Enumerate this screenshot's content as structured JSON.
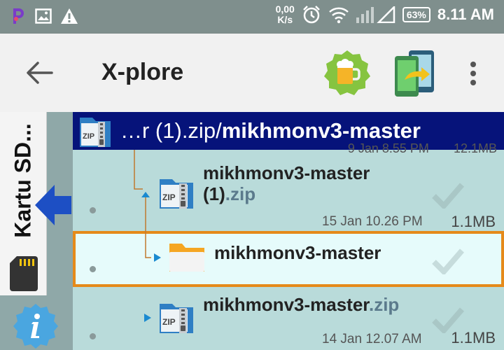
{
  "status_bar": {
    "speed_value": "0,00",
    "speed_unit": "K/s",
    "battery": "63%",
    "time": "8.11 AM",
    "icons": [
      "pinterest-icon",
      "image-icon",
      "warning-icon",
      "alarm-icon",
      "wifi-icon",
      "signal-icon",
      "battery-icon"
    ]
  },
  "app_bar": {
    "title": "X-plore",
    "icons": [
      "back-arrow-icon",
      "beer-icon",
      "phone-transfer-icon",
      "more-vert-icon"
    ]
  },
  "side_panel": {
    "label": "Kartu SD...",
    "icons": [
      "sd-card-icon",
      "arrow-left-icon",
      "info-icon"
    ]
  },
  "path_bar": {
    "prefix": "…r (1).zip/",
    "current": "mikhmonv3-master"
  },
  "list": {
    "cut_row": {
      "date": "9 Jan 8.55 PM",
      "size": "12.1MB"
    },
    "items": [
      {
        "name_line1": "mikhmonv3-master",
        "name_line2": "(1)",
        "ext": ".zip",
        "date": "15 Jan 10.26 PM",
        "size": "1.1MB",
        "type": "zip"
      },
      {
        "name": "mikhmonv3-master",
        "type": "folder",
        "selected": true
      },
      {
        "name": "mikhmonv3-master",
        "ext": ".zip",
        "date": "14 Jan 12.07 AM",
        "size": "1.1MB",
        "type": "zip"
      }
    ]
  },
  "colors": {
    "status_bar": "#7f8f8d",
    "app_bar": "#f1f1f1",
    "path_bar": "#06137a",
    "list_bg": "#b9dbda",
    "selected_bg": "#e6fbfb",
    "selected_border": "#e58a1a",
    "tree_line": "#c07a30",
    "tree_arrow": "#1a8ad0"
  }
}
